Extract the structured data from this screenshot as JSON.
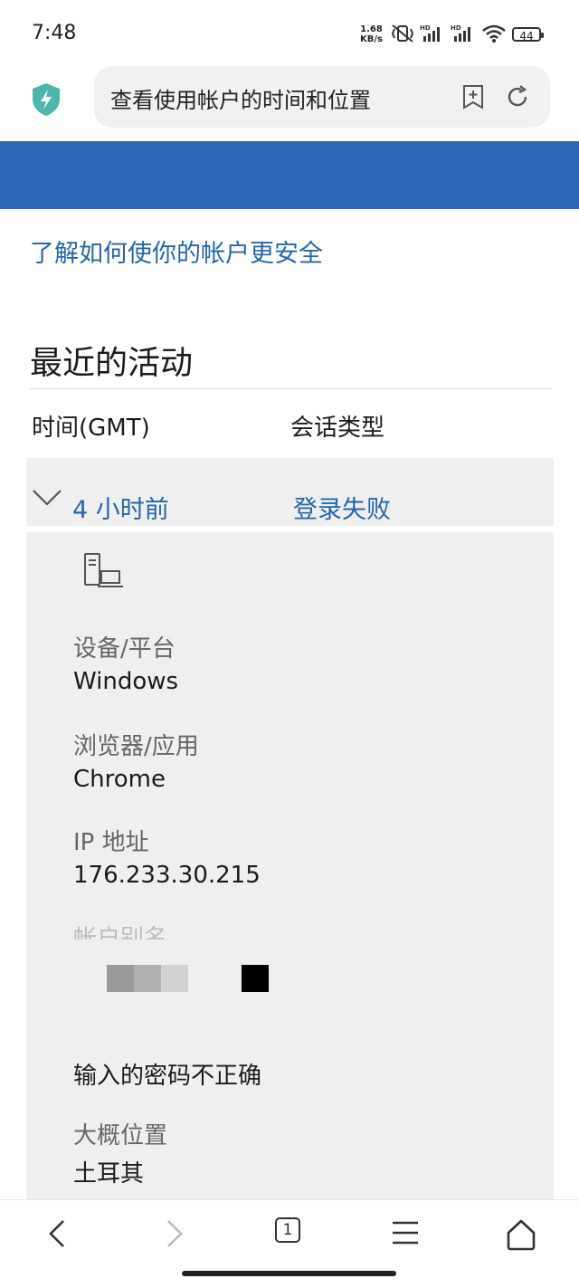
{
  "status_bar": {
    "time": "7:48",
    "net_rate_value": "1.68",
    "net_rate_unit": "KB/s",
    "battery": "44"
  },
  "browser": {
    "url_text": "查看使用帐户的时间和位置",
    "shield_color": "#4db6ac",
    "icons": [
      "shield-bolt-icon",
      "bookmark-add-icon",
      "refresh-icon"
    ]
  },
  "page": {
    "learn_link": "了解如何使你的帐户更安全",
    "section_title": "最近的活动",
    "columns": {
      "time": "时间(GMT)",
      "session_type": "会话类型"
    },
    "activity": {
      "when": "4 小时前",
      "type": "登录失败",
      "device_label": "设备/平台",
      "device_value": "Windows",
      "browser_label": "浏览器/应用",
      "browser_value": "Chrome",
      "ip_label": "IP 地址",
      "ip_value": "176.233.30.215",
      "alias_label": "帐户别名",
      "result_value": "输入的密码不正确",
      "location_label": "大概位置",
      "location_value": "土耳其"
    },
    "colors": {
      "link": "#2666a6",
      "band": "#2b68b8",
      "panel": "#efefef"
    }
  },
  "bottom_nav": {
    "tab_count": "1",
    "icons": [
      "back-icon",
      "forward-icon",
      "tabs-icon",
      "menu-icon",
      "home-icon"
    ]
  }
}
